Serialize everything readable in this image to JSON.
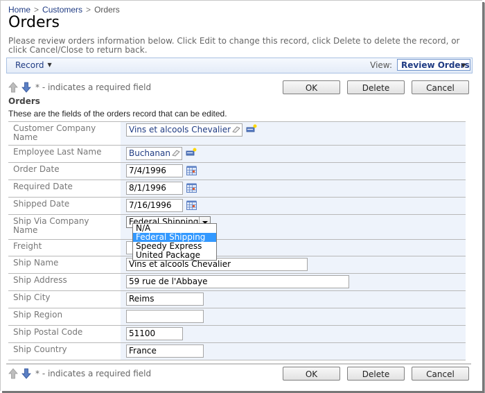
{
  "breadcrumb": [
    {
      "label": "Home",
      "link": true
    },
    {
      "label": "Customers",
      "link": true
    },
    {
      "label": "Orders",
      "link": false
    }
  ],
  "breadcrumb_separator": ">",
  "page": {
    "title": "Orders",
    "description": "Please review orders information below. Click Edit to change this record, click Delete to delete the record, or click Cancel/Close to return back."
  },
  "actionbar": {
    "record_menu": "Record",
    "view_label": "View:",
    "view_selected": "Review Orders"
  },
  "nav": {
    "required_text": "* - indicates a required field",
    "buttons": {
      "ok": "OK",
      "delete": "Delete",
      "cancel": "Cancel"
    }
  },
  "section": {
    "title": "Orders",
    "description": "These are the fields of the orders record that can be edited."
  },
  "fields": {
    "customer_company_name": {
      "label": "Customer Company Name",
      "value": "Vins et alcools Chevalier"
    },
    "employee_last_name": {
      "label": "Employee Last Name",
      "value": "Buchanan"
    },
    "order_date": {
      "label": "Order Date",
      "value": "7/4/1996"
    },
    "required_date": {
      "label": "Required Date",
      "value": "8/1/1996"
    },
    "shipped_date": {
      "label": "Shipped Date",
      "value": "7/16/1996"
    },
    "ship_via": {
      "label": "Ship Via Company Name",
      "value": "Federal Shipping",
      "options": [
        "N/A",
        "Federal Shipping",
        "Speedy Express",
        "United Package"
      ],
      "highlighted": "Federal Shipping"
    },
    "freight": {
      "label": "Freight",
      "value": ""
    },
    "ship_name": {
      "label": "Ship Name",
      "value": "Vins et alcools Chevalier"
    },
    "ship_address": {
      "label": "Ship Address",
      "value": "59 rue de l'Abbaye"
    },
    "ship_city": {
      "label": "Ship City",
      "value": "Reims"
    },
    "ship_region": {
      "label": "Ship Region",
      "value": ""
    },
    "ship_postal_code": {
      "label": "Ship Postal Code",
      "value": "51100"
    },
    "ship_country": {
      "label": "Ship Country",
      "value": "France"
    }
  },
  "colors": {
    "link": "#1f3b83",
    "value_column_bg": "#eef3fb",
    "dropdown_highlight": "#3399ff"
  }
}
